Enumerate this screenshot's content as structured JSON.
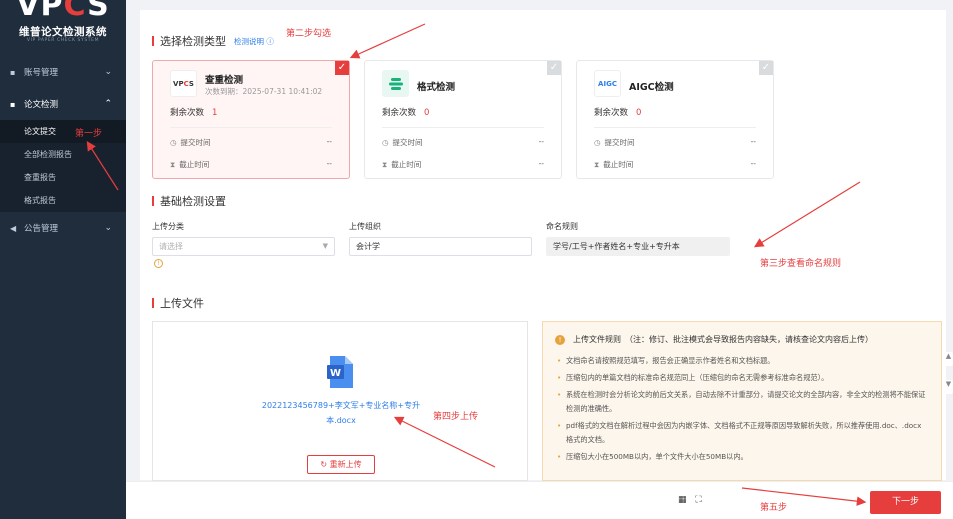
{
  "brand": {
    "logo_prefix": "VP",
    "logo_c": "C",
    "logo_suffix": "S",
    "title": "维普论文检测系统",
    "subtitle": "VIP PAPER CHECK SYSTEM"
  },
  "sidebar": {
    "menus": [
      {
        "label": "账号管理",
        "icon": "user-icon",
        "expanded": false
      },
      {
        "label": "论文检测",
        "icon": "document-icon",
        "expanded": true,
        "children": [
          "论文提交",
          "全部检测报告",
          "查重报告",
          "格式报告"
        ],
        "active_child": 0
      },
      {
        "label": "公告管理",
        "icon": "megaphone-icon",
        "expanded": false
      }
    ]
  },
  "sections": {
    "type_title": "选择检测类型",
    "type_help": "检测说明",
    "basic_title": "基础检测设置",
    "upload_title": "上传文件"
  },
  "cards": [
    {
      "name": "查重检测",
      "logo": "VPCS",
      "expire": "次数到期：2025-07-31 10:41:02",
      "remain_label": "剩余次数",
      "remain": "1",
      "submit_label": "提交时间",
      "submit_value": "--",
      "deadline_label": "截止时间",
      "deadline_value": "--",
      "selected": true
    },
    {
      "name": "格式检测",
      "logo": "format-logo",
      "remain_label": "剩余次数",
      "remain": "0",
      "submit_label": "提交时间",
      "submit_value": "--",
      "deadline_label": "截止时间",
      "deadline_value": "--",
      "selected": false
    },
    {
      "name": "AIGC检测",
      "logo": "AIGC",
      "remain_label": "剩余次数",
      "remain": "0",
      "submit_label": "提交时间",
      "submit_value": "--",
      "deadline_label": "截止时间",
      "deadline_value": "--",
      "selected": false
    }
  ],
  "settings": {
    "category_label": "上传分类",
    "category_placeholder": "请选择",
    "org_label": "上传组织",
    "org_value": "会计学",
    "naming_label": "命名规则",
    "naming_value": "学号/工号+作者姓名+专业+专升本"
  },
  "upload": {
    "file_name": "2022123456789+李文军+专业名称+专升本.docx",
    "reupload_label": "重新上传"
  },
  "rules": {
    "heading": "上传文件规则　（注：修订、批注模式会导致报告内容缺失，请核查论文内容后上传）",
    "items": [
      "文档命名请按照规范填写，报告会正确显示作者姓名和文档标题。",
      "压缩包内的单篇文档的标准命名规范同上（压缩包的命名无需参考标准命名规范）。",
      "系统在检测时会分析论文的前后文关系，自动去除不计重部分，请提交论文的全部内容，非全文的检测将不能保证检测的准确性。",
      "pdf格式的文档在解析过程中会因为内嵌字体、文档格式不正规等原因导致解析失败，所以推荐使用.doc、.docx格式的文档。",
      "压缩包大小在500MB以内，单个文件大小在50MB以内。"
    ]
  },
  "footer": {
    "next_label": "下一步"
  },
  "annotations": {
    "step1": "第一步",
    "step2": "第二步勾选",
    "step3": "第三步查看命名规则",
    "step4": "第四步上传",
    "step5": "第五步"
  },
  "colors": {
    "accent": "#e63d3d",
    "sidebar": "#1f2d3d",
    "link": "#2d7ee8",
    "warning": "#e6a23c"
  }
}
